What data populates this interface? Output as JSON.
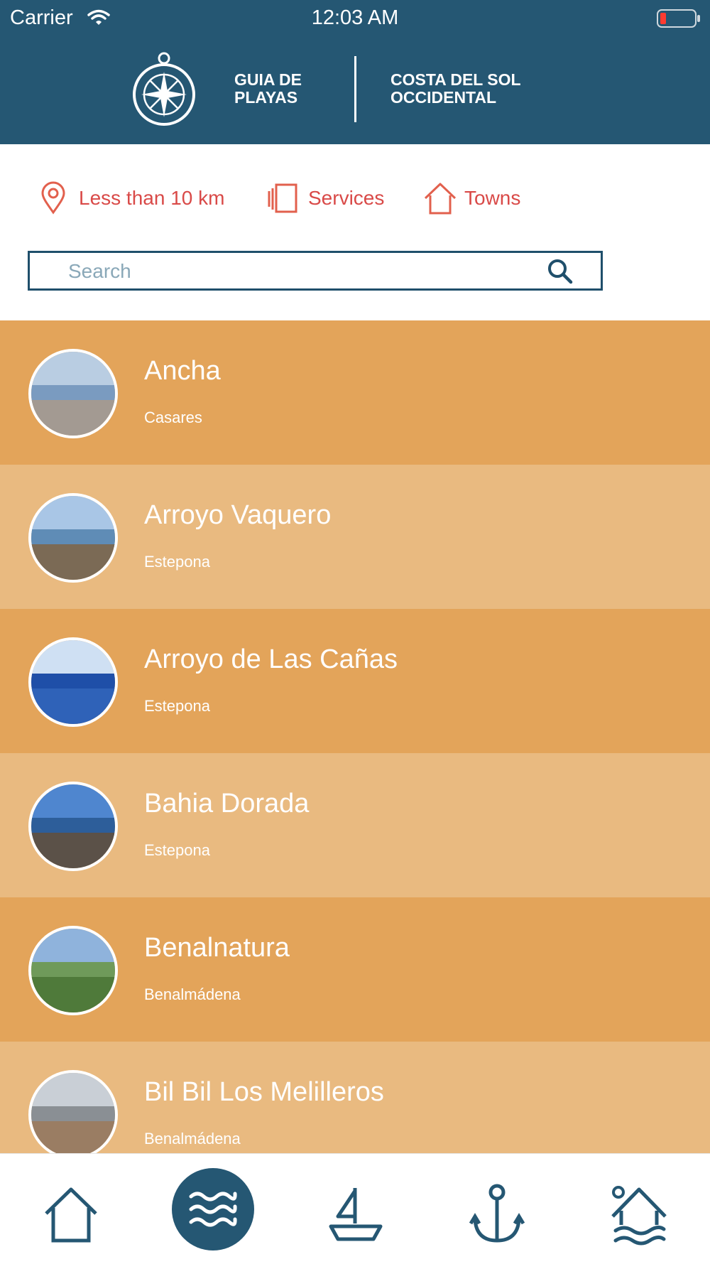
{
  "status_bar": {
    "carrier": "Carrier",
    "time": "12:03 AM"
  },
  "header": {
    "brand_left": "GUIA DE PLAYAS",
    "brand_right": "COSTA DEL SOL OCCIDENTAL"
  },
  "filters": [
    {
      "label": "Less than 10 km",
      "icon": "location-pin-icon"
    },
    {
      "label": "Services",
      "icon": "cards-icon"
    },
    {
      "label": "Towns",
      "icon": "house-icon"
    }
  ],
  "search": {
    "placeholder": "Search",
    "value": ""
  },
  "beaches": [
    {
      "name": "Ancha",
      "town": "Casares"
    },
    {
      "name": "Arroyo Vaquero",
      "town": "Estepona"
    },
    {
      "name": "Arroyo de Las Cañas",
      "town": "Estepona"
    },
    {
      "name": "Bahia Dorada",
      "town": "Estepona"
    },
    {
      "name": "Benalnatura",
      "town": "Benalmádena"
    },
    {
      "name": "Bil Bil Los Melilleros",
      "town": "Benalmádena"
    }
  ],
  "tabs": [
    {
      "icon": "home-icon",
      "active": false
    },
    {
      "icon": "waves-icon",
      "active": true
    },
    {
      "icon": "sailboat-icon",
      "active": false
    },
    {
      "icon": "anchor-icon",
      "active": false
    },
    {
      "icon": "beach-house-icon",
      "active": false
    }
  ],
  "colors": {
    "header": "#255773",
    "accent": "#d94a48",
    "row_dark": "#e3a45a",
    "row_light": "#e9ba80"
  }
}
